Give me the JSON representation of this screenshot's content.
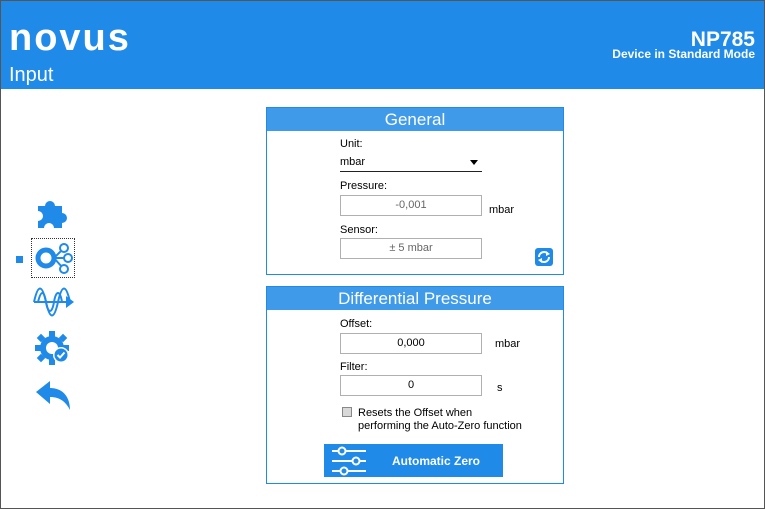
{
  "header": {
    "logo": "novus",
    "page_title": "Input",
    "model": "NP785",
    "mode": "Device in Standard Mode"
  },
  "sidebar": {
    "icons": [
      "puzzle-icon",
      "input-network-icon",
      "signal-wave-icon",
      "gear-check-icon",
      "back-arrow-icon"
    ],
    "selected": "input-network-icon"
  },
  "general": {
    "title": "General",
    "unit_label": "Unit:",
    "unit_value": "mbar",
    "pressure_label": "Pressure:",
    "pressure_value": "-0,001",
    "pressure_unit": "mbar",
    "sensor_label": "Sensor:",
    "sensor_value": "± 5 mbar"
  },
  "differential": {
    "title": "Differential Pressure",
    "offset_label": "Offset:",
    "offset_value": "0,000",
    "offset_unit": "mbar",
    "filter_label": "Filter:",
    "filter_value": "0",
    "filter_unit": "s",
    "checkbox_label_1": "Resets the Offset when",
    "checkbox_label_2": "performing the Auto-Zero function",
    "auto_zero_label": "Automatic Zero"
  },
  "colors": {
    "accent": "#1f8ae8",
    "panel_head": "#3f9ae9"
  }
}
